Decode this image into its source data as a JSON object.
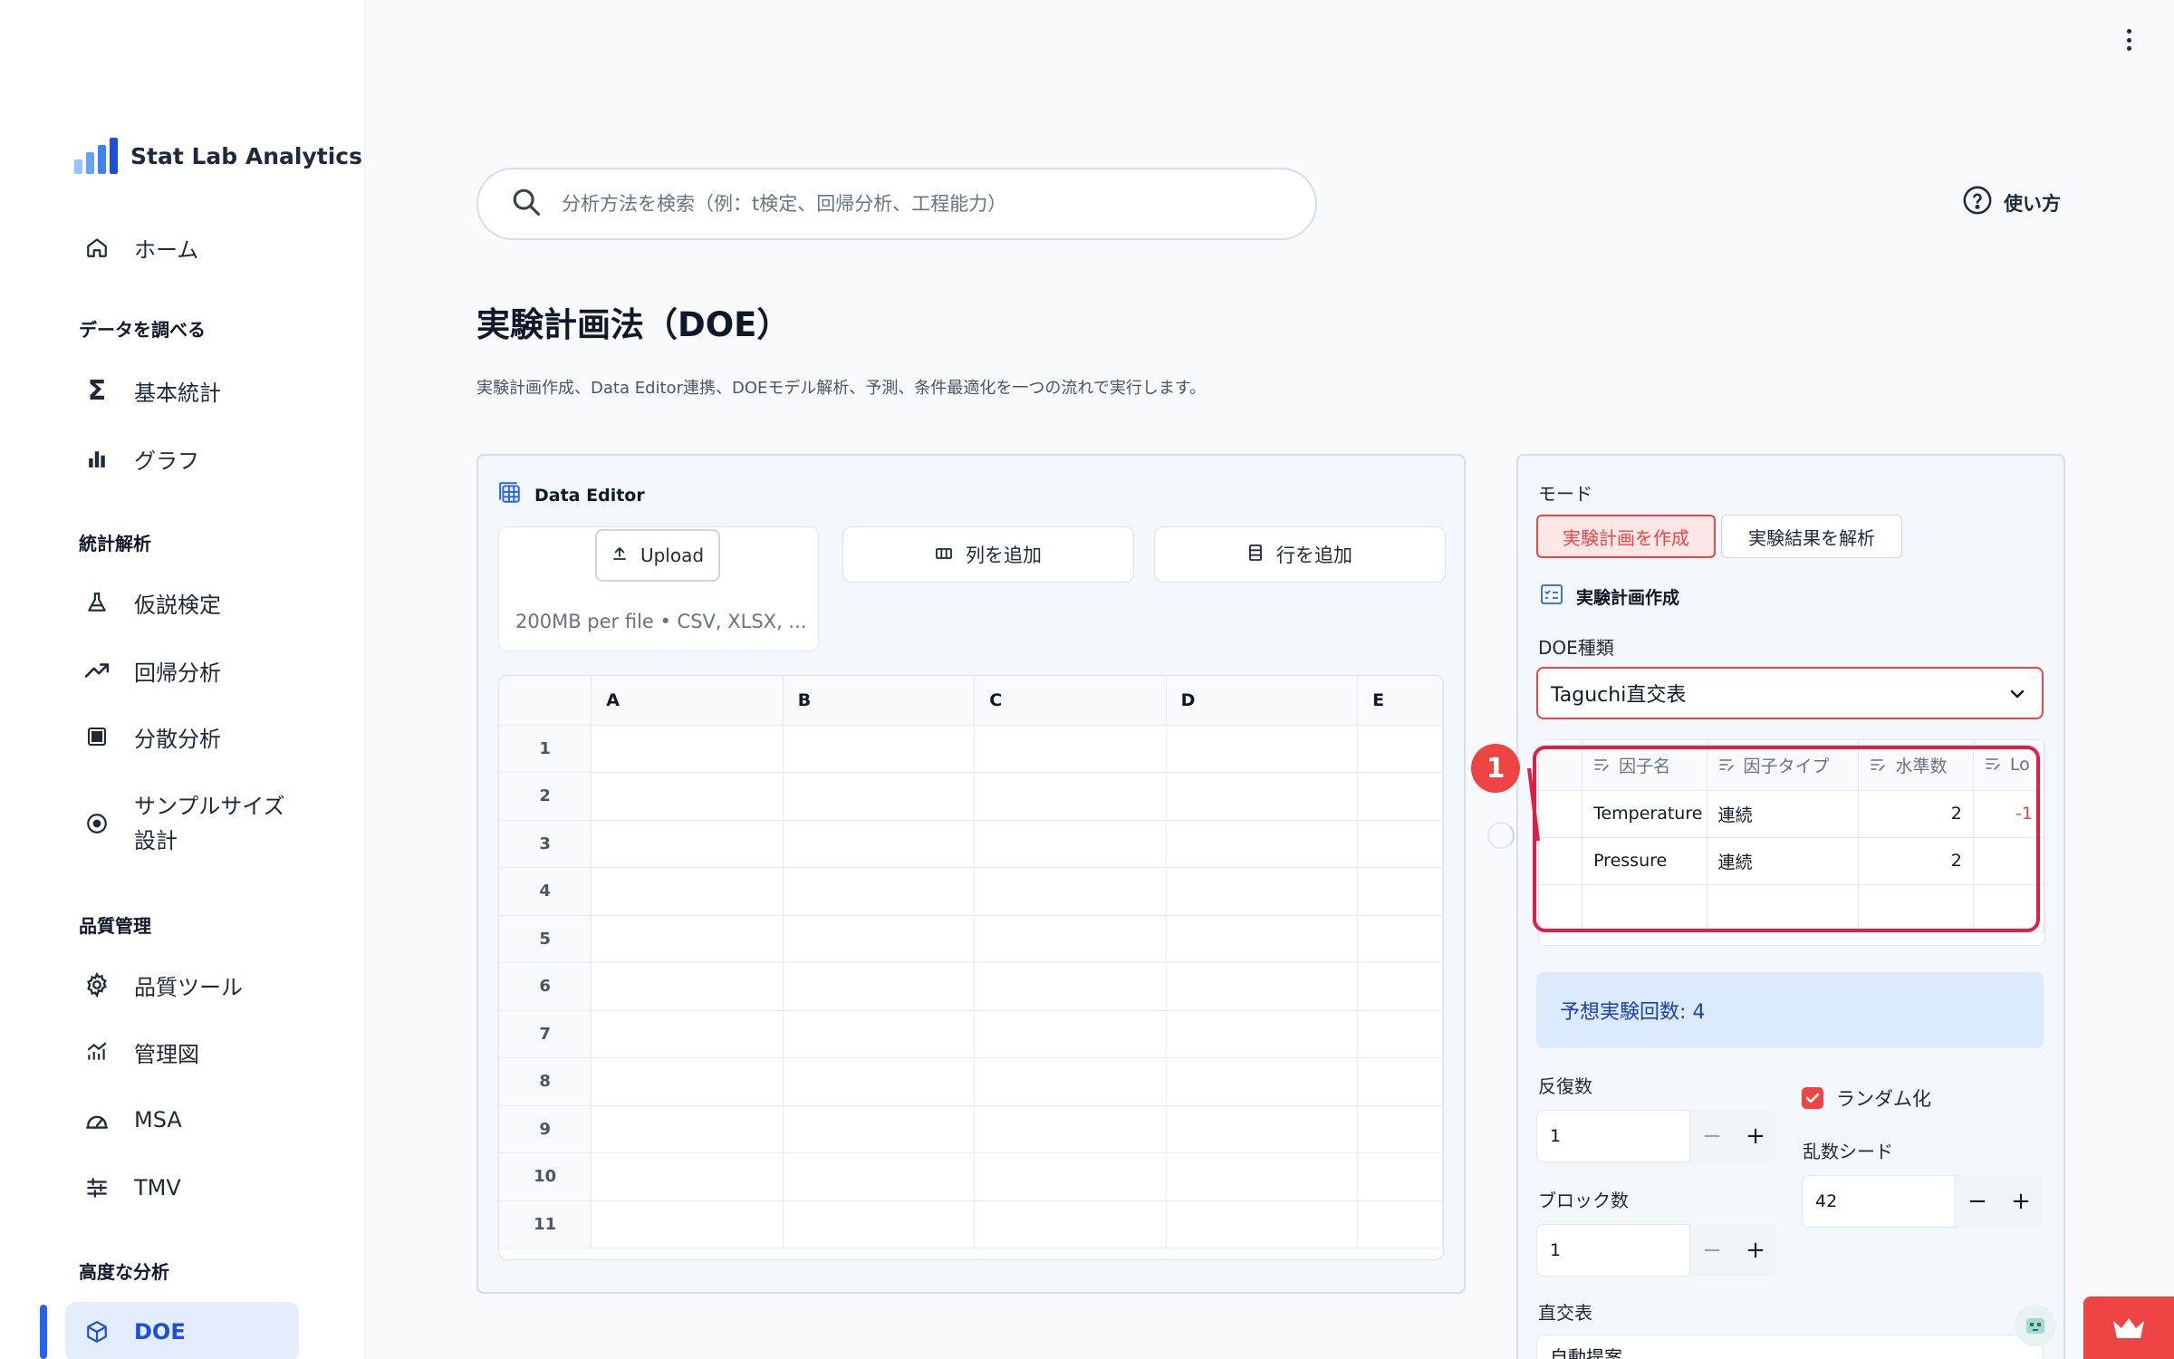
{
  "app": {
    "name": "Stat Lab Analytics",
    "logo_colors": [
      "#93c5fd",
      "#60a5fa",
      "#3b82f6",
      "#1d4ed8"
    ]
  },
  "sidebar": {
    "home": "ホーム",
    "sections": [
      {
        "title": "データを調べる",
        "items": [
          "基本統計",
          "グラフ"
        ]
      },
      {
        "title": "統計解析",
        "items": [
          "仮説検定",
          "回帰分析",
          "分散分析",
          "サンプルサイズ\n設計"
        ]
      },
      {
        "title": "品質管理",
        "items": [
          "品質ツール",
          "管理図",
          "MSA",
          "TMV"
        ]
      },
      {
        "title": "高度な分析",
        "items": [
          "DOE"
        ]
      }
    ],
    "active_item": "DOE",
    "accent": "#2563eb"
  },
  "header": {
    "search_placeholder": "分析方法を検索（例：t検定、回帰分析、工程能力）",
    "help_label": "使い方"
  },
  "page": {
    "title": "実験計画法（DOE）",
    "subtitle": "実験計画作成、Data Editor連携、DOEモデル解析、予測、条件最適化を一つの流れで実行します。"
  },
  "data_editor": {
    "title": "Data Editor",
    "upload_label": "Upload",
    "upload_hint": "200MB per file • CSV, XLSX, ...",
    "add_column": "列を追加",
    "add_row": "行を追加",
    "columns": [
      "A",
      "B",
      "C",
      "D",
      "E"
    ],
    "rows": [
      "1",
      "2",
      "3",
      "4",
      "5",
      "6",
      "7",
      "8",
      "9",
      "10",
      "11"
    ]
  },
  "design": {
    "mode_label": "モード",
    "mode_create": "実験計画を作成",
    "mode_analyze": "実験結果を解析",
    "section_title": "実験計画作成",
    "doe_type_label": "DOE種類",
    "doe_type_value": "Taguchi直交表",
    "factor_columns": [
      "因子名",
      "因子タイプ",
      "水準数",
      "Lo"
    ],
    "factors": [
      {
        "name": "Temperature",
        "type": "連続",
        "levels": "2",
        "low": "-1"
      },
      {
        "name": "Pressure",
        "type": "連続",
        "levels": "2",
        "low": ""
      }
    ],
    "annotation_number": "1",
    "expected_runs": "予想実験回数: 4",
    "replicates_label": "反復数",
    "replicates_value": "1",
    "blocks_label": "ブロック数",
    "blocks_value": "1",
    "randomize_label": "ランダム化",
    "randomize_checked": true,
    "seed_label": "乱数シード",
    "seed_value": "42",
    "orthogonal_label": "直交表",
    "orthogonal_value": "自動提案",
    "highlight_color": "#e11d48"
  }
}
